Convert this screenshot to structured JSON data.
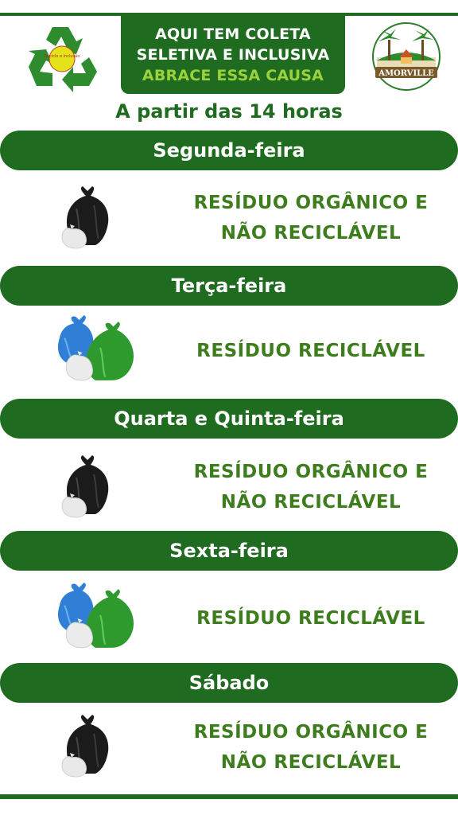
{
  "header": {
    "recycle_logo_text": "Reciclo e Inclusão",
    "banner_line1": "AQUI TEM COLETA",
    "banner_line2": "SELETIVA E INCLUSIVA",
    "banner_line3": "ABRACE ESSA CAUSA",
    "amorville_logo_text": "AMORVILLE",
    "subtitle": "A partir das 14 horas"
  },
  "colors": {
    "brand_green": "#1f6b1f",
    "accent_green": "#9bd23c",
    "text_green": "#3d7d1e"
  },
  "schedule": [
    {
      "day": "Segunda-feira",
      "bag_icon": "black-trash-bag-icon",
      "waste_line1": "RESÍDUO ORGÂNICO E",
      "waste_line2": "NÃO RECICLÁVEL"
    },
    {
      "day": "Terça-feira",
      "bag_icon": "recycling-bags-icon",
      "waste_line1": "RESÍDUO RECICLÁVEL"
    },
    {
      "day": "Quarta e Quinta-feira",
      "bag_icon": "black-trash-bag-icon",
      "waste_line1": "RESÍDUO ORGÂNICO E",
      "waste_line2": "NÃO RECICLÁVEL"
    },
    {
      "day": "Sexta-feira",
      "bag_icon": "recycling-bags-icon",
      "waste_line1": "RESÍDUO RECICLÁVEL"
    },
    {
      "day": "Sábado",
      "bag_icon": "black-trash-bag-icon",
      "waste_line1": "RESÍDUO ORGÂNICO E",
      "waste_line2": "NÃO RECICLÁVEL"
    }
  ]
}
